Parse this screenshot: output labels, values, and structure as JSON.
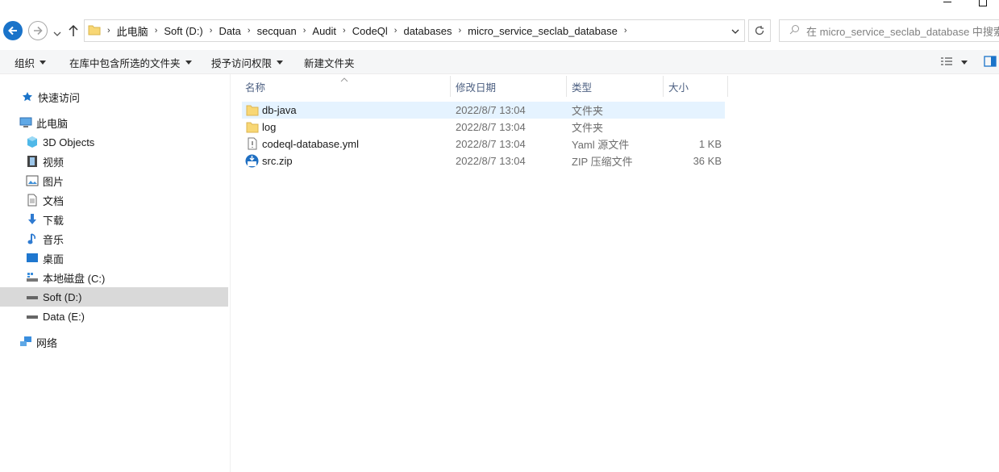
{
  "address": {
    "crumbs": [
      "此电脑",
      "Soft (D:)",
      "Data",
      "secquan",
      "Audit",
      "CodeQl",
      "databases",
      "micro_service_seclab_database"
    ]
  },
  "search": {
    "placeholder": "在 micro_service_seclab_database 中搜索"
  },
  "commands": {
    "organize": "组织",
    "include_library": "在库中包含所选的文件夹",
    "share": "授予访问权限",
    "new_folder": "新建文件夹"
  },
  "nav": {
    "quick_access": "快速访问",
    "this_pc": "此电脑",
    "objects3d": "3D Objects",
    "videos": "视频",
    "pictures": "图片",
    "documents": "文档",
    "downloads": "下载",
    "music": "音乐",
    "desktop": "桌面",
    "local_c": "本地磁盘 (C:)",
    "soft_d": "Soft (D:)",
    "data_e": "Data (E:)",
    "network": "网络"
  },
  "columns": {
    "name": "名称",
    "modified": "修改日期",
    "type": "类型",
    "size": "大小"
  },
  "files": [
    {
      "name": "db-java",
      "modified": "2022/8/7 13:04",
      "type": "文件夹",
      "size": "",
      "icon": "folder-icon"
    },
    {
      "name": "log",
      "modified": "2022/8/7 13:04",
      "type": "文件夹",
      "size": "",
      "icon": "folder-icon"
    },
    {
      "name": "codeql-database.yml",
      "modified": "2022/8/7 13:04",
      "type": "Yaml 源文件",
      "size": "1 KB",
      "icon": "yaml-file-icon"
    },
    {
      "name": "src.zip",
      "modified": "2022/8/7 13:04",
      "type": "ZIP 压缩文件",
      "size": "36 KB",
      "icon": "zip-file-icon"
    }
  ],
  "colors": {
    "accent": "#1a73c9",
    "selected_row": "#e5f3ff",
    "selected_nav": "#d9d9d9",
    "folder": "#f8d775"
  }
}
